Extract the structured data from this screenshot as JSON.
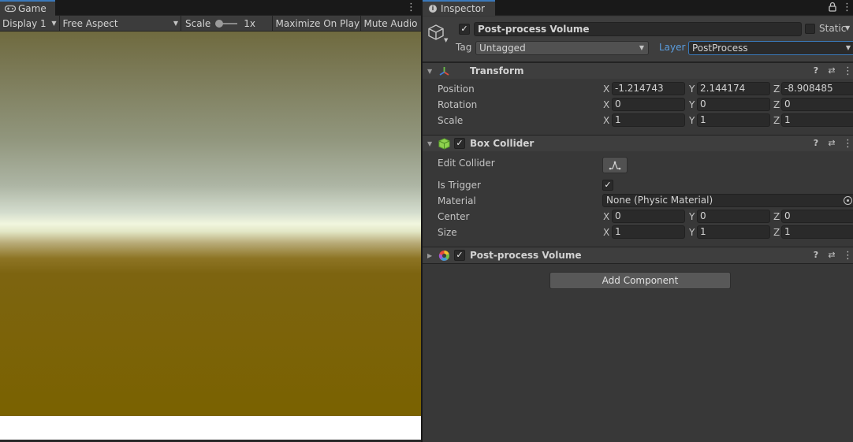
{
  "game": {
    "tab_label": "Game",
    "toolbar": {
      "display": "Display 1",
      "aspect": "Free Aspect",
      "scale_label": "Scale",
      "scale_value": "1x",
      "maximize": "Maximize On Play",
      "mute": "Mute Audio"
    }
  },
  "inspector": {
    "tab_label": "Inspector",
    "object": {
      "name": "Post-process Volume",
      "static_label": "Static",
      "tag_label": "Tag",
      "tag_value": "Untagged",
      "layer_label": "Layer",
      "layer_value": "PostProcess"
    },
    "components": {
      "transform": {
        "title": "Transform",
        "rows": [
          {
            "label": "Position",
            "x": "-1.214743",
            "y": "2.144174",
            "z": "-8.908485"
          },
          {
            "label": "Rotation",
            "x": "0",
            "y": "0",
            "z": "0"
          },
          {
            "label": "Scale",
            "x": "1",
            "y": "1",
            "z": "1"
          }
        ]
      },
      "box_collider": {
        "title": "Box Collider",
        "edit_collider_label": "Edit Collider",
        "is_trigger_label": "Is Trigger",
        "material_label": "Material",
        "material_value": "None (Physic Material)",
        "center": {
          "label": "Center",
          "x": "0",
          "y": "0",
          "z": "0"
        },
        "size": {
          "label": "Size",
          "x": "1",
          "y": "1",
          "z": "1"
        }
      },
      "post_process_volume": {
        "title": "Post-process Volume"
      }
    },
    "add_component_label": "Add Component"
  },
  "axis_labels": {
    "x": "X",
    "y": "Y",
    "z": "Z"
  },
  "icons": {
    "game_tab": "gamepad-icon",
    "inspector_tab": "info-icon",
    "lock": "lock-icon",
    "object": "cube-icon",
    "transform": "transform-gizmo-icon",
    "box_collider": "box-collider-icon",
    "post_process": "post-process-icon",
    "help": "help-icon",
    "preset": "preset-icon",
    "menu": "kebab-menu-icon"
  },
  "colors": {
    "accent": "#3a79bb",
    "layer_label": "#5b9dde",
    "panel_bg": "#383838",
    "game_ground": "#7a6200"
  }
}
